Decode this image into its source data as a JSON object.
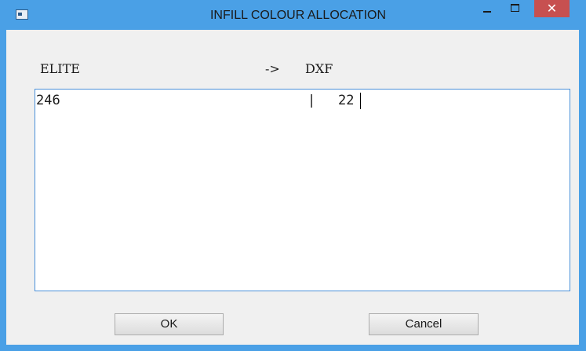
{
  "window": {
    "title": "INFILL COLOUR ALLOCATION",
    "close_glyph": "✕",
    "icons": {
      "app": "window-app-icon",
      "minimize": "minimize-icon",
      "maximize": "maximize-icon",
      "close": "close-icon"
    },
    "colors": {
      "titlebar": "#4aa0e6",
      "close_button": "#c75050",
      "client_background": "#f0f0f0",
      "edit_border": "#4a90d9"
    }
  },
  "header": {
    "source_label": "ELITE",
    "arrow": "->",
    "target_label": "DXF"
  },
  "mapping": {
    "rows": [
      {
        "elite": "246",
        "separator": "|",
        "dxf": "22"
      }
    ]
  },
  "buttons": {
    "ok": "OK",
    "cancel": "Cancel"
  }
}
